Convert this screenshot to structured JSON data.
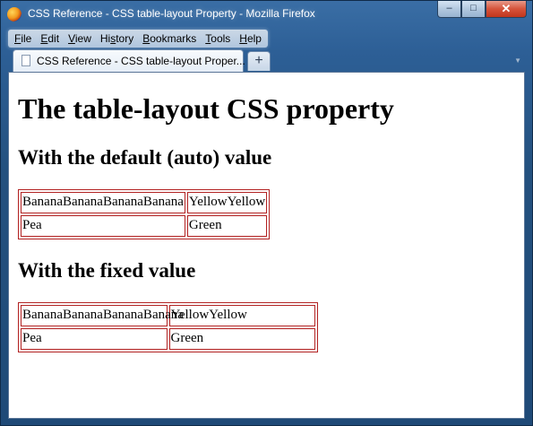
{
  "window": {
    "title": "CSS Reference - CSS table-layout Property - Mozilla Firefox",
    "controls": {
      "minimize": "–",
      "maximize": "□",
      "close": "✕"
    }
  },
  "menubar": {
    "items": [
      {
        "accel": "F",
        "rest": "ile"
      },
      {
        "accel": "E",
        "rest": "dit"
      },
      {
        "accel": "V",
        "rest": "iew"
      },
      {
        "pre": "Hi",
        "accel": "s",
        "rest": "tory"
      },
      {
        "accel": "B",
        "rest": "ookmarks"
      },
      {
        "accel": "T",
        "rest": "ools"
      },
      {
        "accel": "H",
        "rest": "elp"
      }
    ]
  },
  "tabs": {
    "active_label": "CSS Reference - CSS table-layout Proper...",
    "new_tab_label": "+",
    "list_all_label": "▼"
  },
  "page": {
    "heading": "The table-layout CSS property",
    "section_auto": "With the default (auto) value",
    "section_fixed": "With the fixed value",
    "table_auto": [
      [
        "BananaBananaBananaBanana",
        "YellowYellow"
      ],
      [
        "Pea",
        "Green"
      ]
    ],
    "table_fixed": [
      [
        "BananaBananaBananaBanana",
        "YellowYellow"
      ],
      [
        "Pea",
        "Green"
      ]
    ]
  }
}
